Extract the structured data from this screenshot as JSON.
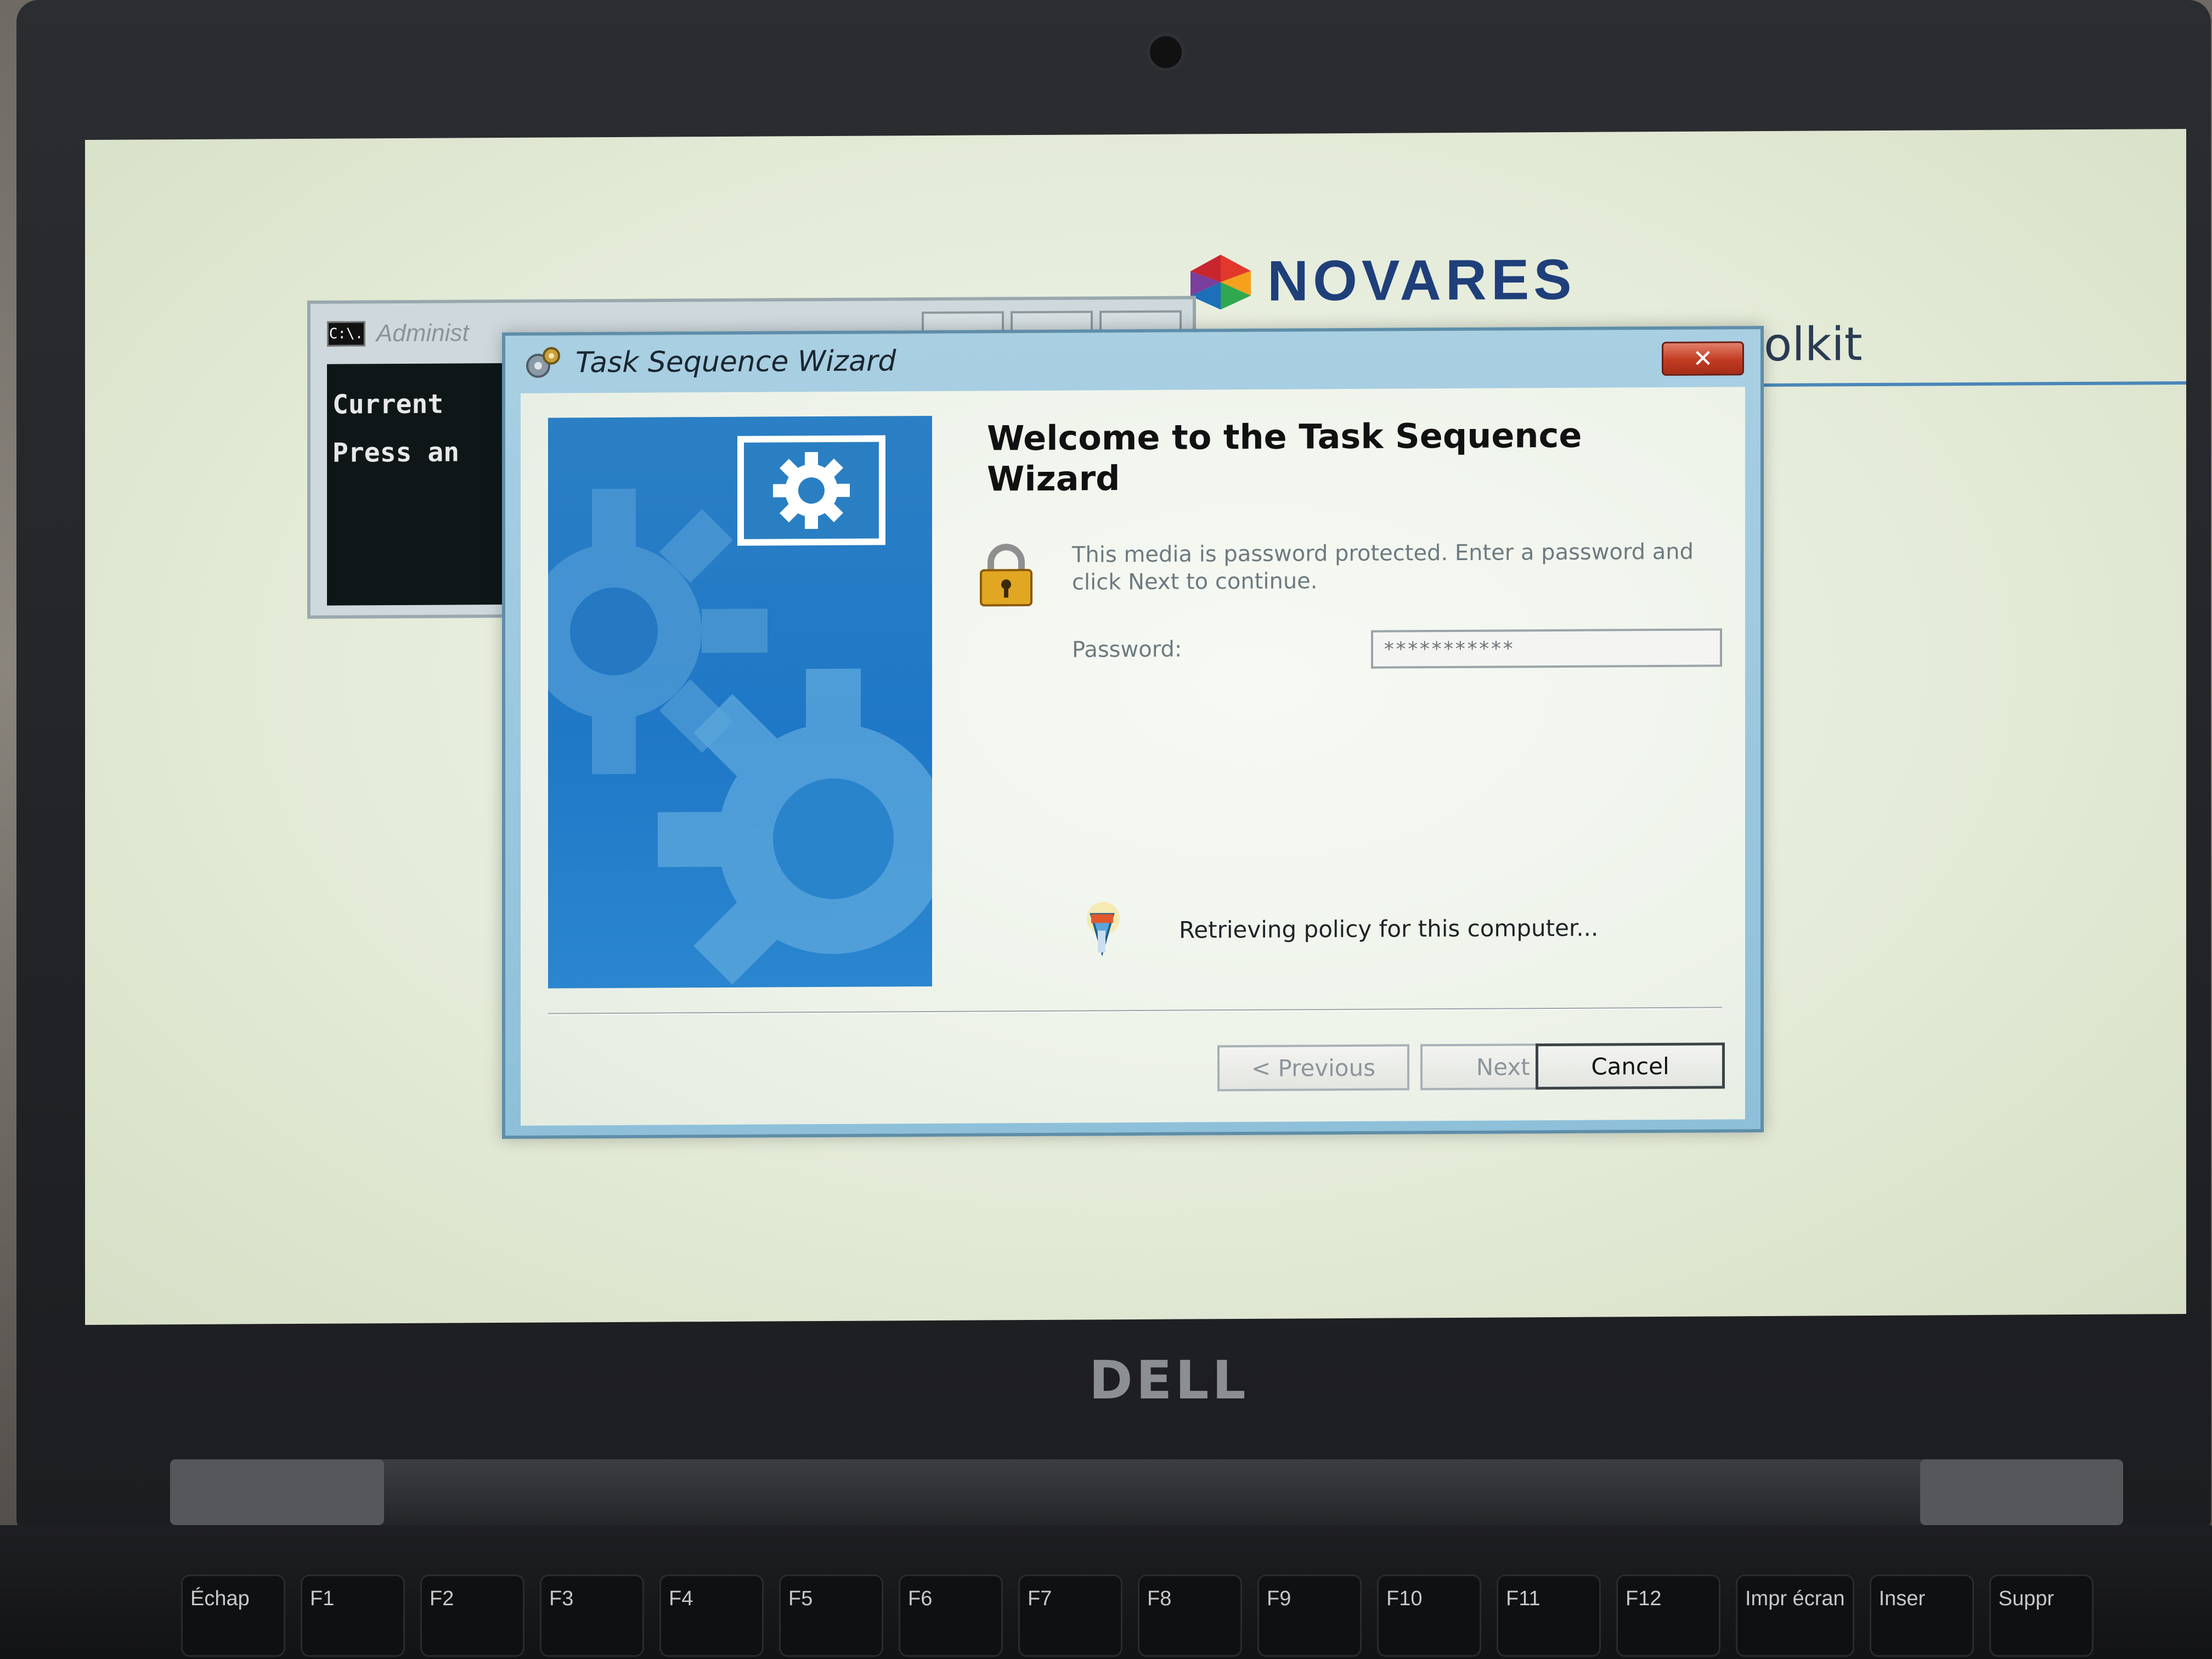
{
  "brand": {
    "logo_text": "NOVARES",
    "accent": "#1f3f7a",
    "background_title": "olkit"
  },
  "console": {
    "title": "Administ",
    "icon_label": "C:\\.",
    "lines": [
      "Current ",
      "Press an"
    ]
  },
  "wizard": {
    "title": "Task Sequence Wizard",
    "close_label": "✕",
    "heading": "Welcome to the Task Sequence Wizard",
    "info": "This media is password protected.  Enter a password and click Next to continue.",
    "password_label": "Password:",
    "password_value": "***********",
    "status": "Retrieving policy for this computer...",
    "buttons": {
      "previous": "< Previous",
      "next": "Next >",
      "cancel": "Cancel"
    },
    "panel_color": "#1f78c6"
  },
  "laptop": {
    "brand": "DELL",
    "keys": [
      "Échap",
      "F1",
      "F2",
      "F3",
      "F4",
      "F5",
      "F6",
      "F7",
      "F8",
      "F9",
      "F10",
      "F11",
      "F12",
      "Impr écran",
      "Inser",
      "Suppr"
    ]
  }
}
